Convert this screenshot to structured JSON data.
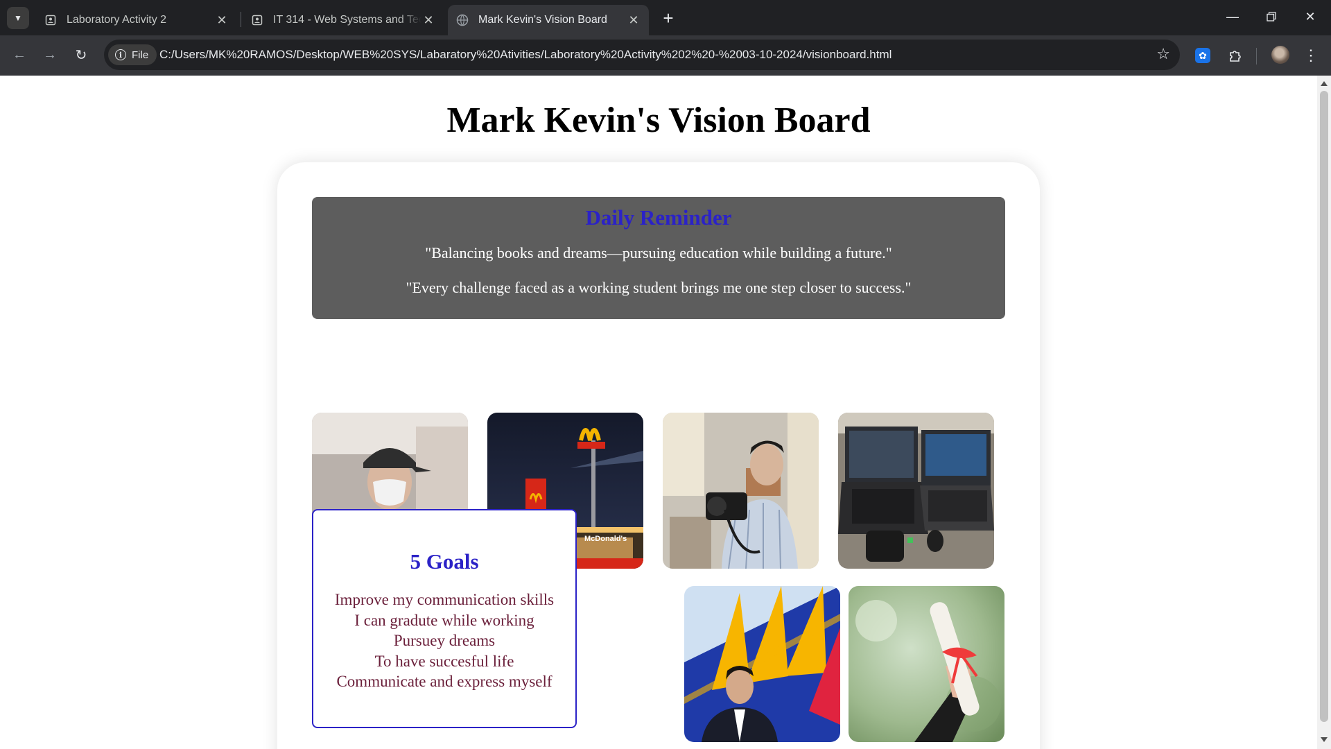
{
  "browser": {
    "tabs": [
      {
        "title": "Laboratory Activity 2",
        "active": false
      },
      {
        "title": "IT 314 - Web Systems and Technologies",
        "active": false
      },
      {
        "title": "Mark Kevin's Vision Board",
        "active": true
      }
    ],
    "chip_label": "File",
    "url": "C:/Users/MK%20RAMOS/Desktop/WEB%20SYS/Labaratory%20Ativities/Laboratory%20Activity%202%20-%2003-10-2024/visionboard.html"
  },
  "page": {
    "title": "Mark Kevin's Vision Board",
    "reminder": {
      "heading": "Daily Reminder",
      "quotes": [
        "\"Balancing books and dreams—pursuing education while building a future.\"",
        "\"Every challenge faced as a working student brings me one step closer to success.\""
      ]
    },
    "photos_row1": [
      "crew-member-portrait",
      "mcdonalds-store-night",
      "photographer-with-camera",
      "laptop-workstation"
    ],
    "goals": {
      "heading": "5 Goals",
      "items": [
        "Improve my communication skills",
        "I can gradute while working",
        "Pursuey dreams",
        "To have succesful life",
        "Communicate and express myself"
      ]
    },
    "photos_row2": [
      "pilot-airline-tail",
      "graduation-diploma"
    ]
  },
  "colors": {
    "heading_blue": "#2b22c7",
    "reminder_bg": "#5d5d5d",
    "goals_text": "#6a1f3a",
    "browser_bg": "#202124"
  }
}
